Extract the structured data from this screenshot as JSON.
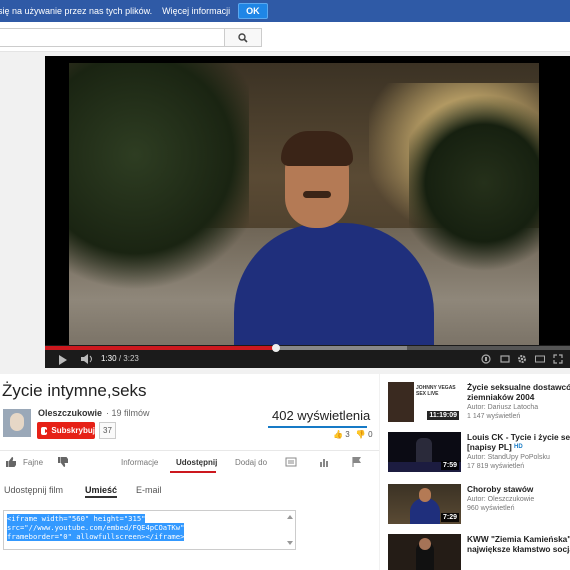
{
  "cookie_bar": {
    "text": "się na używanie przez nas tych plików.",
    "more_link": "Więcej informacji",
    "ok_button": "OK"
  },
  "search": {
    "placeholder": "",
    "value": ""
  },
  "player": {
    "current_time": "1:30",
    "duration": "3:23",
    "progress": 0.44,
    "buffered": 0.69
  },
  "video": {
    "title": "Życie intymne,seks",
    "channel_name": "Oleszczukowie",
    "channel_video_count": "· 19 filmów",
    "subscribe_label": "Subskrybuj",
    "subscriber_count": "37",
    "views": "402 wyświetlenia",
    "likes": "3",
    "dislikes": "0"
  },
  "action_tabs": [
    {
      "label": "Fajne"
    },
    {
      "label": "Informacje"
    },
    {
      "label": "Udostępnij"
    },
    {
      "label": "Dodaj do"
    }
  ],
  "share_tabs": [
    {
      "label": "Udostępnij film"
    },
    {
      "label": "Umieść"
    },
    {
      "label": "E-mail"
    }
  ],
  "embed_code": [
    "<iframe width=\"560\" height=\"315\"",
    "src=\"//www.youtube.com/embed/FQE4pCOaTKw\"",
    "frameborder=\"0\" allowfullscreen></iframe>"
  ],
  "recommendations": [
    {
      "title_lines": [
        "Życie seksualne dostawców",
        "ziemniaków 2004"
      ],
      "author": "Autor: Dariusz Latocha",
      "views": "1 147 wyświetleń",
      "duration": "11:19:09",
      "thumb_text": "JOHNNY VEGAS SEX LIVE"
    },
    {
      "title_lines": [
        "Louis CK - Tycie i życie seks",
        "[napisy PL]"
      ],
      "author": "Autor: StandUpy PoPolsku",
      "views": "17 819 wyświetleń",
      "duration": "7:59",
      "hd_badge": "HD"
    },
    {
      "title_lines": [
        "Choroby stawów"
      ],
      "author": "Autor: Oleszczukowie",
      "views": "960 wyświetleń",
      "duration": "7:29"
    },
    {
      "title_lines": [
        "KWW \"Ziemia Kamieńska\"",
        "największe kłamstwo socja"
      ],
      "author": "",
      "views": "",
      "duration": ""
    }
  ],
  "colors": {
    "cookie_bar": "#2f5aa6",
    "subscribe": "#e62117",
    "progress": "#cc181e",
    "views_bar": "#167ac6",
    "selection": "#3399ff"
  }
}
